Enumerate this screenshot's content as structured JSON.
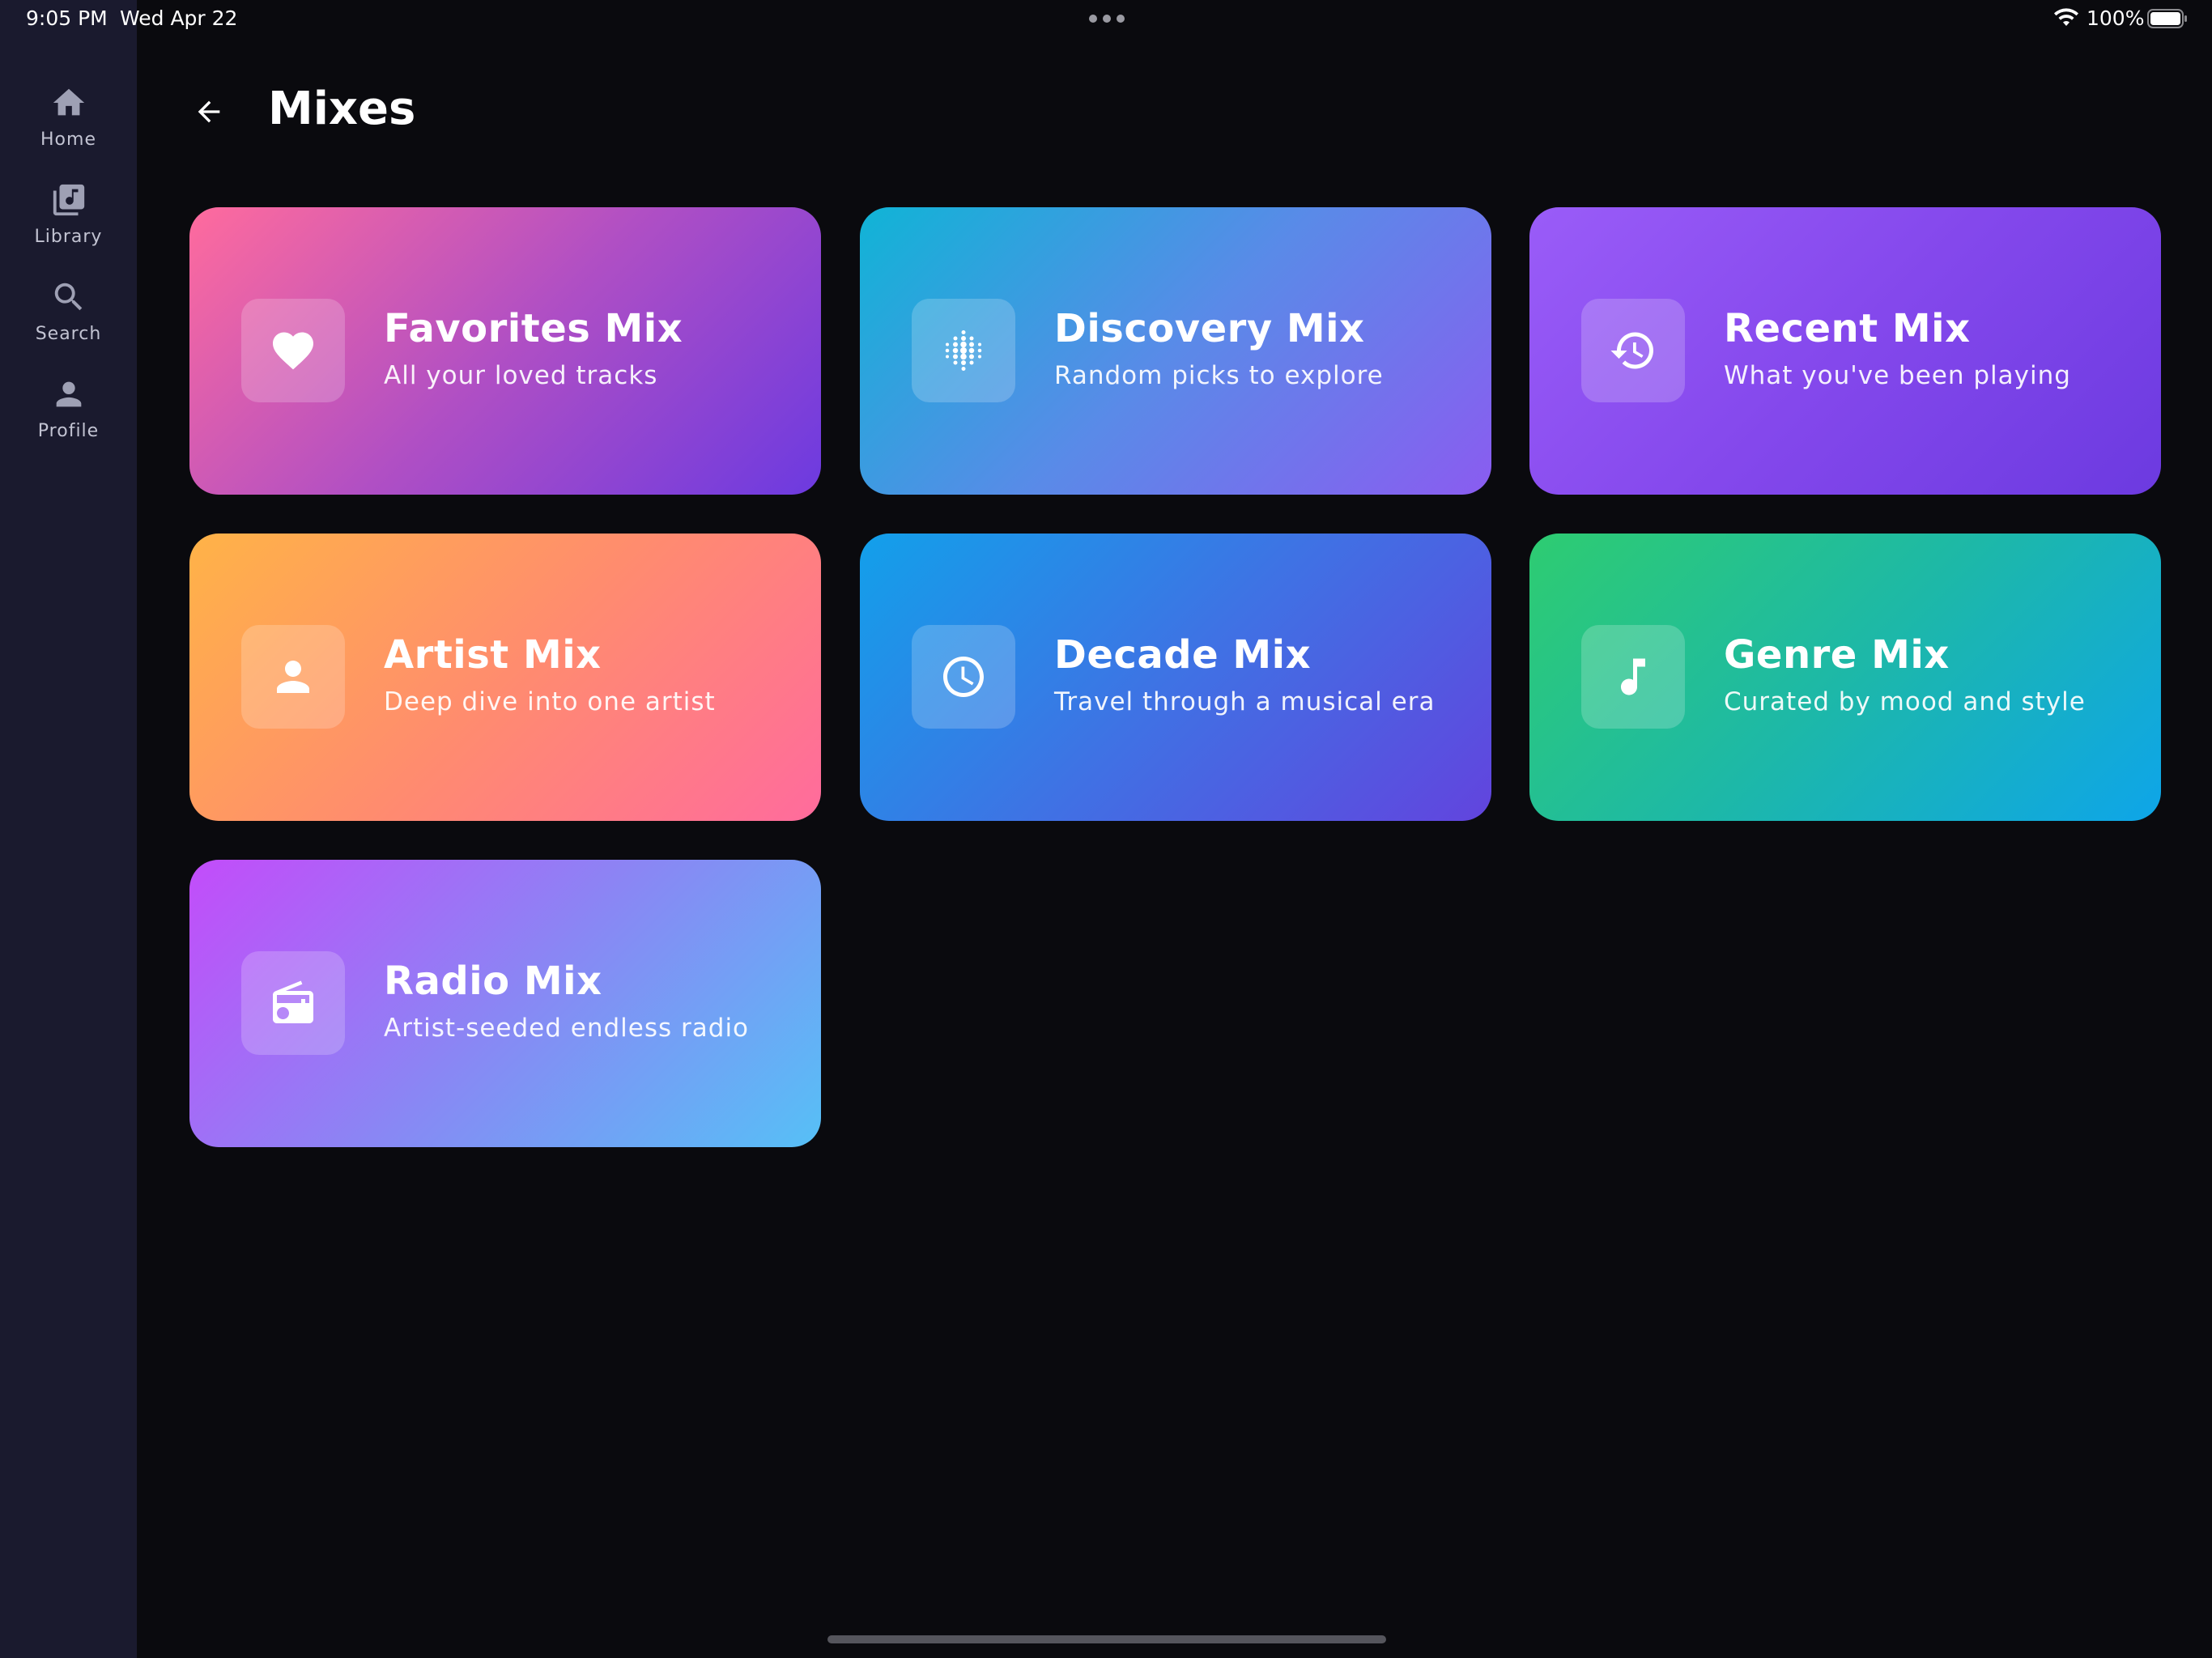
{
  "status_bar": {
    "time": "9:05 PM",
    "date": "Wed Apr 22",
    "battery": "100%"
  },
  "sidebar": {
    "items": [
      {
        "label": "Home",
        "icon": "home-icon"
      },
      {
        "label": "Library",
        "icon": "library-music-icon"
      },
      {
        "label": "Search",
        "icon": "search-icon"
      },
      {
        "label": "Profile",
        "icon": "person-icon"
      }
    ]
  },
  "header": {
    "title": "Mixes"
  },
  "mixes": [
    {
      "title": "Favorites Mix",
      "subtitle": "All your loved tracks",
      "icon": "heart-icon",
      "colors": [
        "#ff6b9d",
        "#6c3ae0"
      ]
    },
    {
      "title": "Discovery Mix",
      "subtitle": "Random picks to explore",
      "icon": "shuffle-dots-icon",
      "colors": [
        "#10b4d6",
        "#8a5cf0"
      ]
    },
    {
      "title": "Recent Mix",
      "subtitle": "What you've been playing",
      "icon": "history-icon",
      "colors": [
        "#9a5cf8",
        "#6c3ae0"
      ]
    },
    {
      "title": "Artist Mix",
      "subtitle": "Deep dive into one artist",
      "icon": "person-icon",
      "colors": [
        "#ffb347",
        "#ff6b9d"
      ]
    },
    {
      "title": "Decade Mix",
      "subtitle": "Travel through a musical era",
      "icon": "clock-icon",
      "colors": [
        "#12a0ea",
        "#6244de"
      ]
    },
    {
      "title": "Genre Mix",
      "subtitle": "Curated by mood and style",
      "icon": "music-note-icon",
      "colors": [
        "#2ecc71",
        "#0ea5e9"
      ]
    },
    {
      "title": "Radio Mix",
      "subtitle": "Artist-seeded endless radio",
      "icon": "radio-icon",
      "colors": [
        "#c34cfa",
        "#56c0f6"
      ]
    }
  ]
}
